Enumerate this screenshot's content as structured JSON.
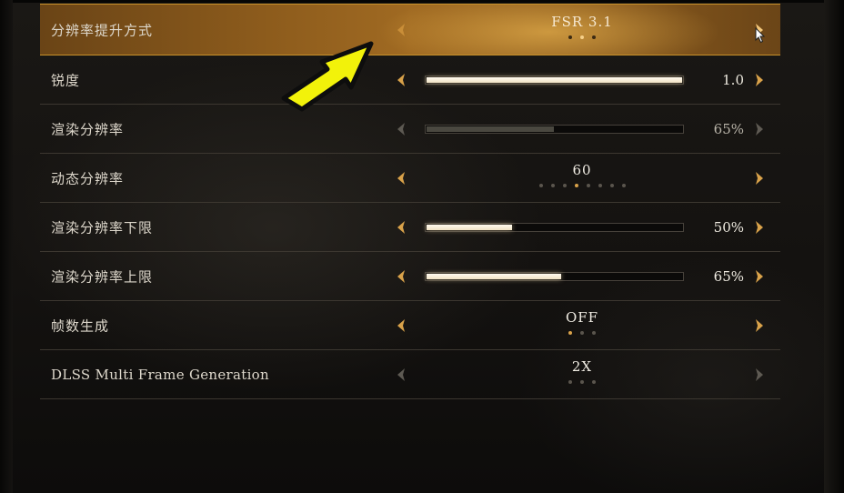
{
  "settings": [
    {
      "label": "分辨率提升方式",
      "type": "choice",
      "value": "FSR 3.1",
      "dots": 3,
      "active_dot": 1,
      "selected": true,
      "enabled": true
    },
    {
      "label": "锐度",
      "type": "slider",
      "value": "1.0",
      "level": 1.0,
      "enabled": true
    },
    {
      "label": "渲染分辨率",
      "type": "slider",
      "value": "65%",
      "level": 0.5,
      "enabled": false
    },
    {
      "label": "动态分辨率",
      "type": "choice",
      "value": "60",
      "dots": 8,
      "active_dot": 3,
      "enabled": true
    },
    {
      "label": "渲染分辨率下限",
      "type": "slider",
      "value": "50%",
      "level": 0.34,
      "enabled": true
    },
    {
      "label": "渲染分辨率上限",
      "type": "slider",
      "value": "65%",
      "level": 0.53,
      "enabled": true
    },
    {
      "label": "帧数生成",
      "type": "choice",
      "value": "OFF",
      "dots": 3,
      "active_dot": 0,
      "enabled": true
    },
    {
      "label": "DLSS Multi Frame Generation",
      "type": "choice",
      "value": "2X",
      "dots": 3,
      "active_dot": -1,
      "enabled": false
    }
  ],
  "colors": {
    "accent": "#d9a24a",
    "selected_row": "#8c5b1c",
    "callout_arrow": "#f2f20a",
    "disabled_arrow": "#6a665e"
  },
  "icons": {
    "left": "chevron-left-icon",
    "right": "chevron-right-icon",
    "callout": "yellow-arrow-annotation",
    "cursor": "mouse-pointer-icon"
  }
}
